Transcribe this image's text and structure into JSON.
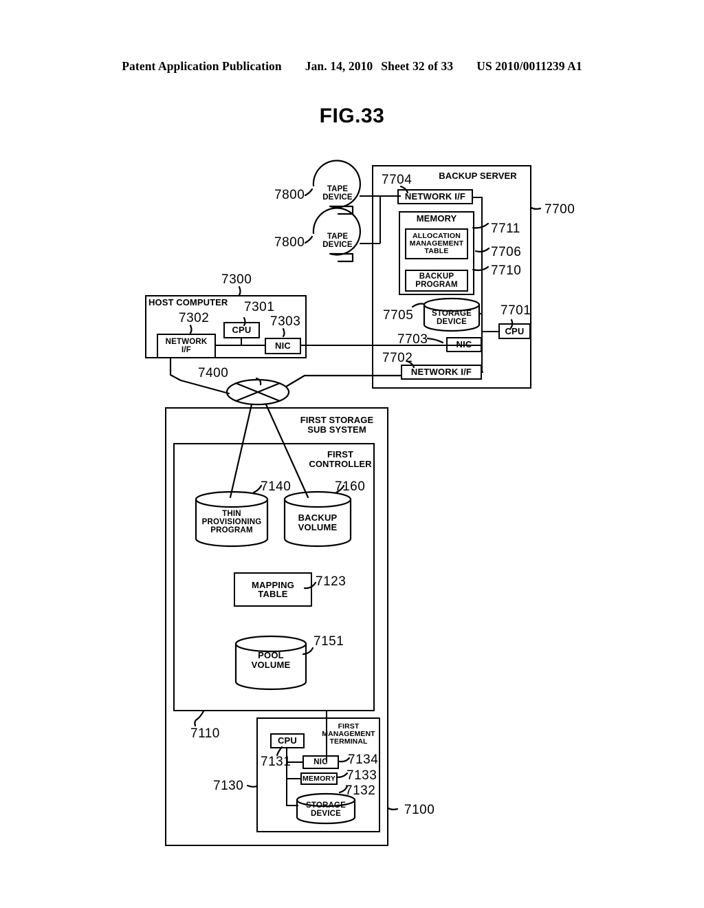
{
  "header": {
    "publication": "Patent Application Publication",
    "date": "Jan. 14, 2010",
    "sheet": "Sheet 32 of 33",
    "docnum": "US 2010/0011239 A1"
  },
  "figure": {
    "title": "FIG.33"
  },
  "tape_devices": [
    {
      "ref": "7800",
      "label": "TAPE\nDEVICE"
    },
    {
      "ref": "7800",
      "label": "TAPE\nDEVICE"
    }
  ],
  "backup_server": {
    "title": "BACKUP SERVER",
    "ref": "7700",
    "network_if_top": {
      "label": "NETWORK I/F",
      "ref": "7704"
    },
    "memory": {
      "label": "MEMORY",
      "ref": "7706",
      "allocation_table": {
        "label": "ALLOCATION\nMANAGEMENT\nTABLE",
        "ref": "7711"
      },
      "backup_program": {
        "label": "BACKUP\nPROGRAM",
        "ref": "7710"
      }
    },
    "storage_device": {
      "label": "STORAGE\nDEVICE",
      "ref": "7705"
    },
    "nic": {
      "label": "NIC",
      "ref": "7703"
    },
    "network_if_bottom": {
      "label": "NETWORK I/F",
      "ref": "7702"
    },
    "cpu": {
      "label": "CPU",
      "ref": "7701"
    }
  },
  "host_computer": {
    "title": "HOST COMPUTER",
    "ref": "7300",
    "cpu": {
      "label": "CPU",
      "ref": "7301"
    },
    "network_if": {
      "label": "NETWORK\nI/F",
      "ref": "7302"
    },
    "nic": {
      "label": "NIC",
      "ref": "7303"
    }
  },
  "switch": {
    "ref": "7400"
  },
  "first_storage_subsystem": {
    "title": "FIRST STORAGE\nSUB SYSTEM",
    "ref": "7100",
    "first_controller": {
      "title": "FIRST\nCONTROLLER",
      "ref": "7110",
      "thin_provisioning_program": {
        "label": "THIN\nPROVISIONING\nPROGRAM",
        "ref": "7140"
      },
      "backup_volume": {
        "label": "BACKUP\nVOLUME",
        "ref": "7160"
      },
      "mapping_table": {
        "label": "MAPPING\nTABLE",
        "ref": "7123"
      },
      "pool_volume": {
        "label": "POOL\nVOLUME",
        "ref": "7151"
      }
    },
    "first_management_terminal": {
      "title": "FIRST\nMANAGEMENT\nTERMINAL",
      "ref": "7130",
      "cpu": {
        "label": "CPU",
        "ref": "7131"
      },
      "nic": {
        "label": "NIC",
        "ref": "7134"
      },
      "memory": {
        "label": "MEMORY",
        "ref": "7133"
      },
      "storage_device": {
        "label": "STORAGE\nDEVICE",
        "ref": "7132"
      }
    }
  }
}
